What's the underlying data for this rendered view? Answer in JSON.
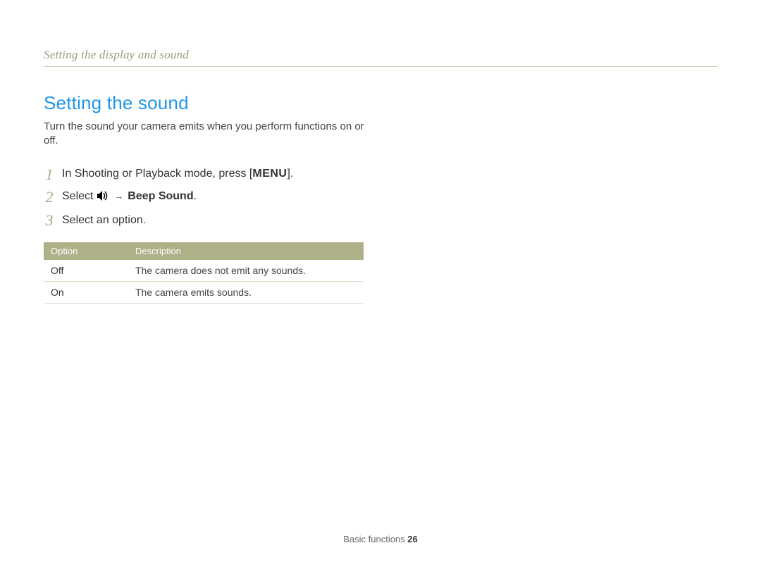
{
  "breadcrumb": "Setting the display and sound",
  "section_title": "Setting the sound",
  "intro": "Turn the sound your camera emits when you perform functions on or off.",
  "steps": {
    "n1": "1",
    "s1_pre": "In Shooting or Playback mode, press [",
    "s1_menu": "MENU",
    "s1_post": "].",
    "n2": "2",
    "s2_select": "Select ",
    "s2_arrow": " → ",
    "s2_bold": "Beep Sound",
    "s2_period": ".",
    "n3": "3",
    "s3": "Select an option."
  },
  "table": {
    "h_option": "Option",
    "h_desc": "Description",
    "r1_opt": "Off",
    "r1_desc": "The camera does not emit any sounds.",
    "r2_opt": "On",
    "r2_desc": "The camera emits sounds."
  },
  "footer": {
    "label": "Basic functions  ",
    "page": "26"
  }
}
